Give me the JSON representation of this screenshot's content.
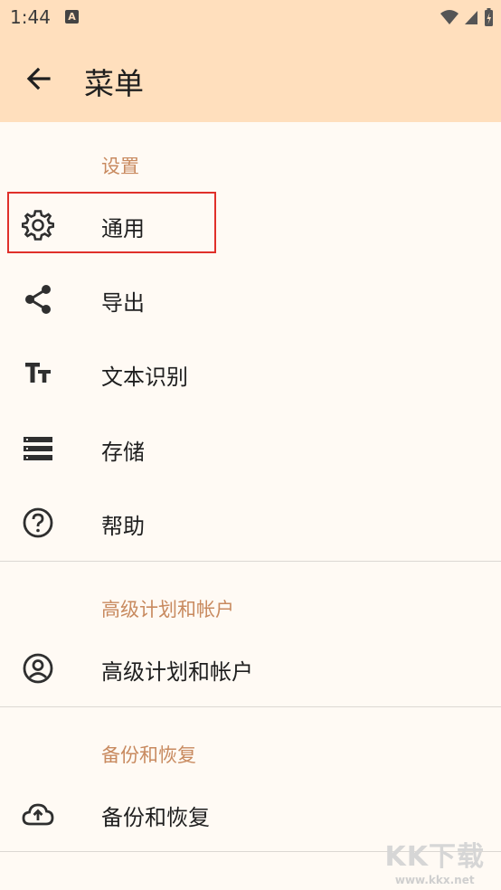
{
  "status": {
    "time": "1:44",
    "a_badge": "A"
  },
  "toolbar": {
    "title": "菜单"
  },
  "sections": {
    "settings": "设置",
    "premium": "高级计划和帐户",
    "backup": "备份和恢复"
  },
  "items": {
    "general": "通用",
    "export": "导出",
    "ocr": "文本识别",
    "storage": "存储",
    "help": "帮助",
    "premium": "高级计划和帐户",
    "backup": "备份和恢复"
  },
  "watermark": {
    "main": "KK下载",
    "url": "www.kkx.net"
  },
  "colors": {
    "header_bg": "#ffdfbd",
    "page_bg": "#fffaf4",
    "section_label": "#c88a5f",
    "highlight_border": "#e0302a"
  }
}
